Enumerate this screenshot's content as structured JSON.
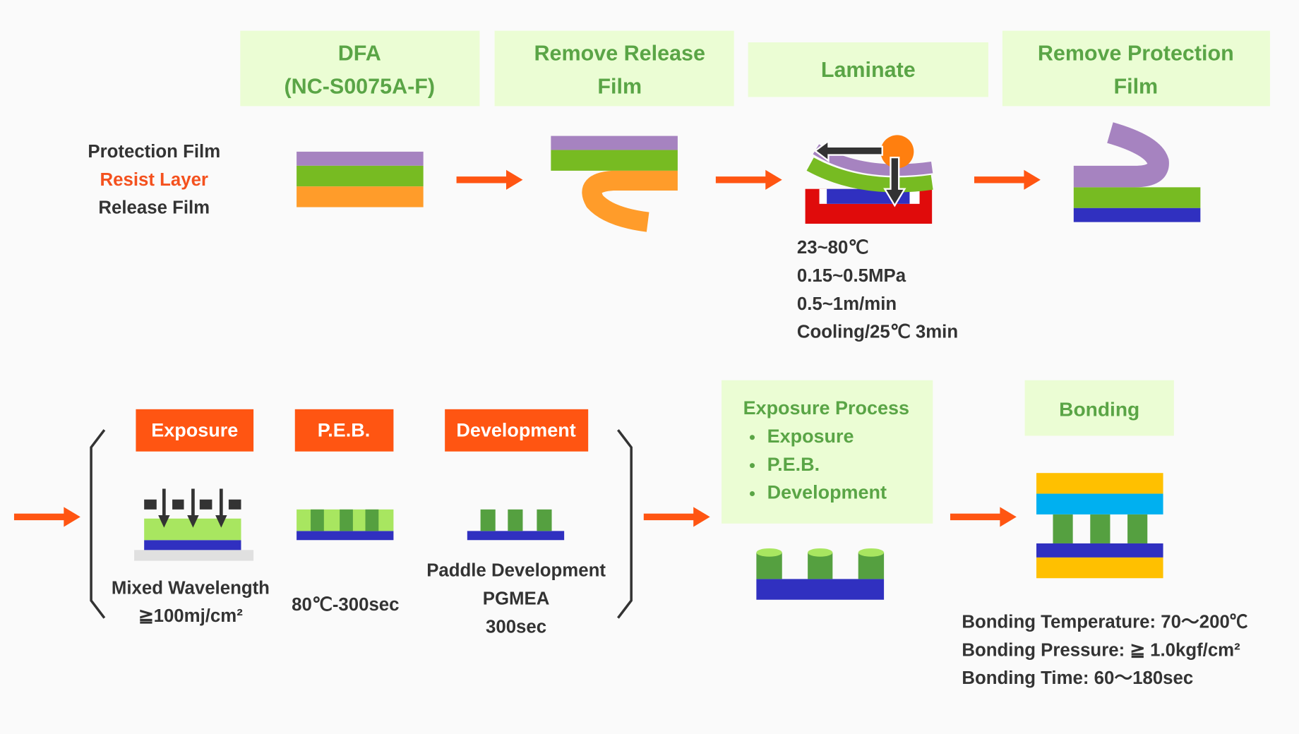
{
  "colors": {
    "header_bg": "#ebfdd4",
    "header_text": "#5aa546",
    "arrow": "#ff5512",
    "protection_film": "#a683c0",
    "resist_layer": "#77bb22",
    "release_film": "#ff9c2a",
    "substrate": "#3030c0",
    "stage": "#e00b0b",
    "bond_outer": "#ffc000",
    "bond_top": "#00b0f0",
    "pattern": "#55a040",
    "exposed_resist": "#a8e660"
  },
  "steps": {
    "dfa": {
      "line1": "DFA",
      "line2": "(NC-S0075A-F)"
    },
    "remove_release": {
      "line1": "Remove Release",
      "line2": "Film"
    },
    "laminate": {
      "title": "Laminate",
      "params": [
        "23~80℃",
        "0.15~0.5MPa",
        "0.5~1m/min",
        "Cooling/25℃ 3min"
      ]
    },
    "remove_protection": {
      "line1": "Remove Protection",
      "line2": "Film"
    }
  },
  "legend": {
    "protection": "Protection Film",
    "resist": "Resist Layer",
    "release": "Release Film"
  },
  "sub_steps": {
    "exposure": {
      "label": "Exposure",
      "notes": [
        "Mixed Wavelength",
        "≧100mj/cm²"
      ]
    },
    "peb": {
      "label": "P.E.B.",
      "notes": [
        "80℃-300sec"
      ]
    },
    "development": {
      "label": "Development",
      "notes": [
        "Paddle Development",
        "PGMEA",
        "300sec"
      ]
    }
  },
  "exposure_process": {
    "title": "Exposure Process",
    "items": [
      "Exposure",
      "P.E.B.",
      "Development"
    ]
  },
  "bonding": {
    "title": "Bonding",
    "params": [
      "Bonding Temperature: 70～200℃",
      "Bonding Pressure: ≧ 1.0kgf/cm²",
      "Bonding Time: 60～180sec"
    ]
  }
}
